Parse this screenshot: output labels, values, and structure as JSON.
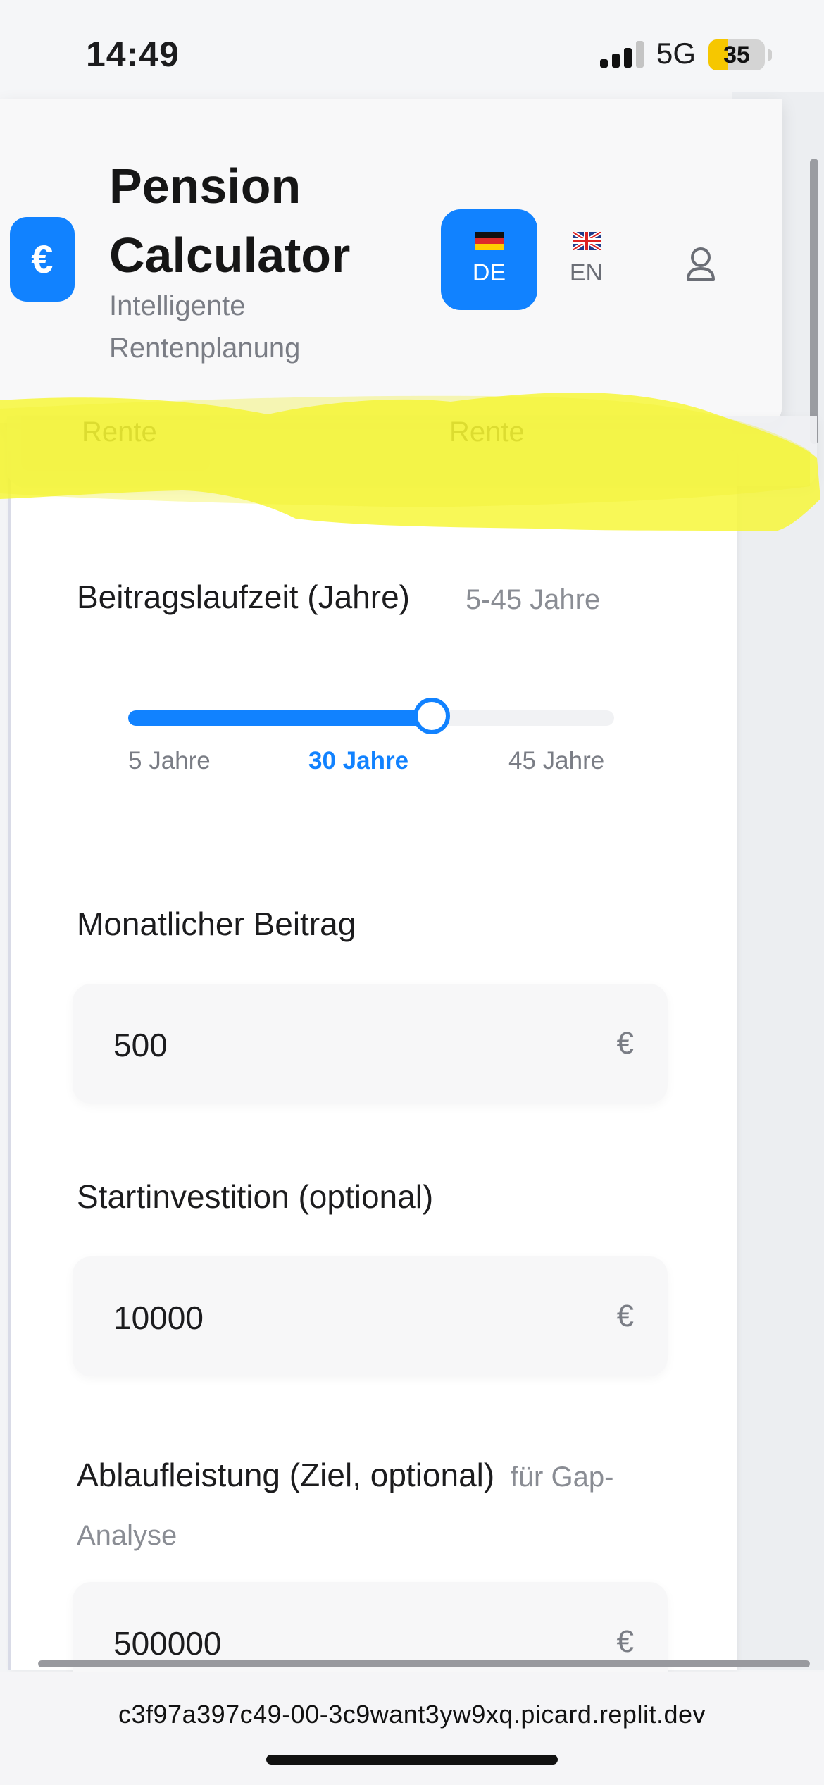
{
  "status_bar": {
    "time": "14:49",
    "network": "5G",
    "battery": "35",
    "battery_level": 0.35
  },
  "header": {
    "logo_symbol": "€",
    "title": "Pension Calculator",
    "subtitle": "Intelligente Rentenplanung",
    "languages": [
      {
        "code": "DE",
        "flag": "german-flag-icon",
        "active": true
      },
      {
        "code": "EN",
        "flag": "uk-flag-icon",
        "active": false
      }
    ],
    "user_icon": "user-icon"
  },
  "tabs": [
    {
      "label": "Rente"
    },
    {
      "label": "Rente"
    }
  ],
  "form": {
    "duration": {
      "label": "Beitragslaufzeit (Jahre)",
      "range_hint": "5-45 Jahre",
      "min": 5,
      "max": 45,
      "value": 30,
      "min_label": "5 Jahre",
      "value_label": "30 Jahre",
      "max_label": "45 Jahre"
    },
    "monthly": {
      "label": "Monatlicher Beitrag",
      "value": "500",
      "currency": "€"
    },
    "start": {
      "label": "Startinvestition (optional)",
      "value": "10000",
      "currency": "€"
    },
    "target": {
      "label": "Ablaufleistung (Ziel, optional)",
      "hint": "für Gap-Analyse",
      "value": "500000",
      "currency": "€"
    }
  },
  "colors": {
    "accent": "#1182ff",
    "highlight": "#f7f732"
  },
  "browser": {
    "url": "c3f97a397c49-00-3c9want3yw9xq.picard.replit.dev"
  }
}
